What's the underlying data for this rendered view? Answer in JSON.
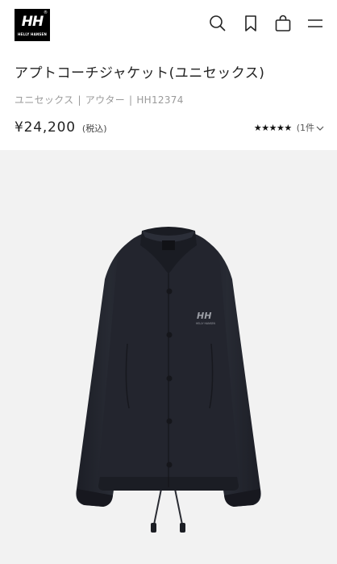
{
  "header": {
    "logo_main": "HH",
    "logo_registered": "®",
    "logo_sub": "HELLY HANSEN",
    "icons": [
      "search-icon",
      "bookmark-icon",
      "shopping-bag-icon",
      "menu-icon"
    ]
  },
  "product": {
    "title": "アプトコーチジャケット(ユニセックス)",
    "breadcrumb": [
      "ユニセックス",
      "アウター",
      "HH12374"
    ],
    "breadcrumb_sep": "|",
    "price": "¥24,200",
    "tax_label": "(税込)",
    "rating_stars": "★★★★★",
    "rating_value": 5,
    "review_count": "(1件",
    "image_logo": "HH",
    "image_logo_sub": "HELLY HANSEN"
  },
  "colors": {
    "logo_bg": "#000000",
    "image_bg": "#f2f2f2",
    "jacket": "#22242d",
    "text_muted": "#9a9a9a"
  }
}
